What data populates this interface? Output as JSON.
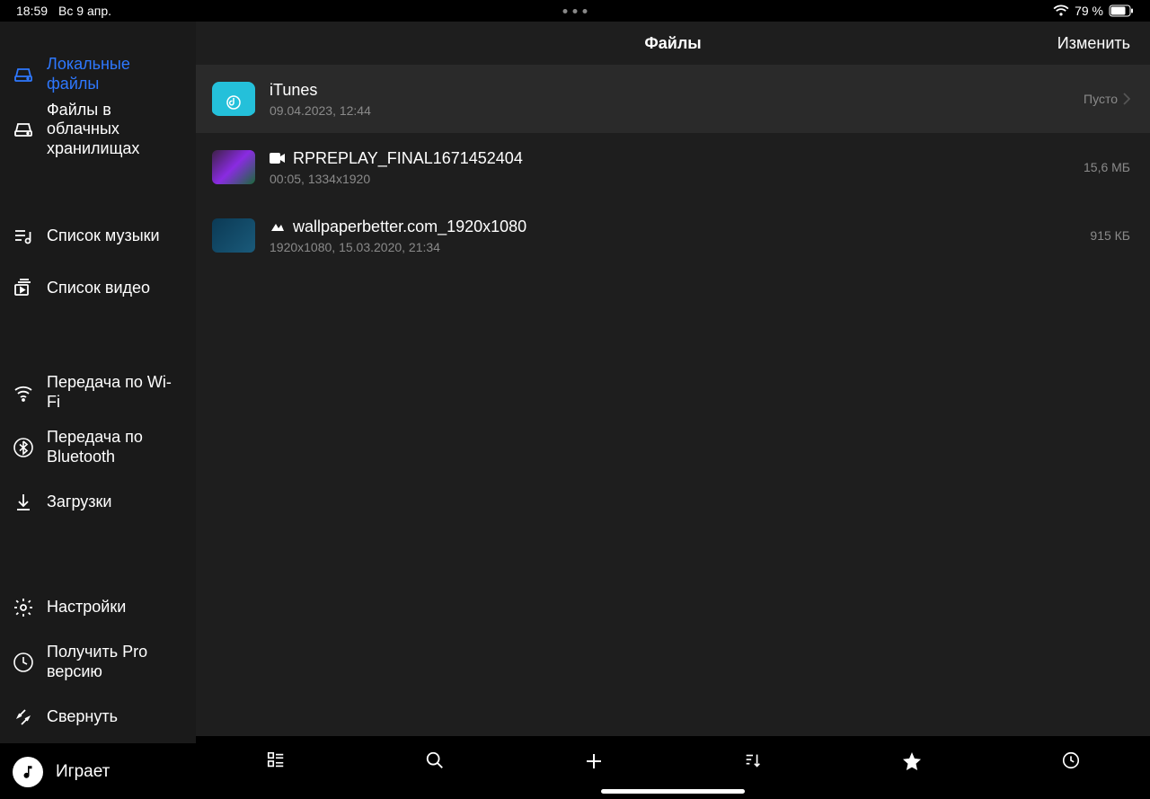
{
  "status": {
    "time": "18:59",
    "date": "Вс 9 апр.",
    "battery": "79 %"
  },
  "sidebar": {
    "items": {
      "local": "Локальные файлы",
      "cloud": "Файлы в облачных хранилищах",
      "music_list": "Список музыки",
      "video_list": "Список видео",
      "wifi": "Передача по Wi-Fi",
      "bluetooth": "Передача по Bluetooth",
      "downloads": "Загрузки",
      "settings": "Настройки",
      "pro": "Получить Pro версию",
      "collapse": "Свернуть"
    },
    "now_playing": "Играет"
  },
  "header": {
    "title": "Файлы",
    "edit": "Изменить"
  },
  "files": [
    {
      "type": "folder",
      "name": "iTunes",
      "meta": "09.04.2023, 12:44",
      "right": "Пусто"
    },
    {
      "type": "video",
      "name": "RPREPLAY_FINAL1671452404",
      "meta": "00:05, 1334x1920",
      "right": "15,6 МБ"
    },
    {
      "type": "image",
      "name": "wallpaperbetter.com_1920x1080",
      "meta": "1920x1080, 15.03.2020, 21:34",
      "right": "915 КБ"
    }
  ]
}
